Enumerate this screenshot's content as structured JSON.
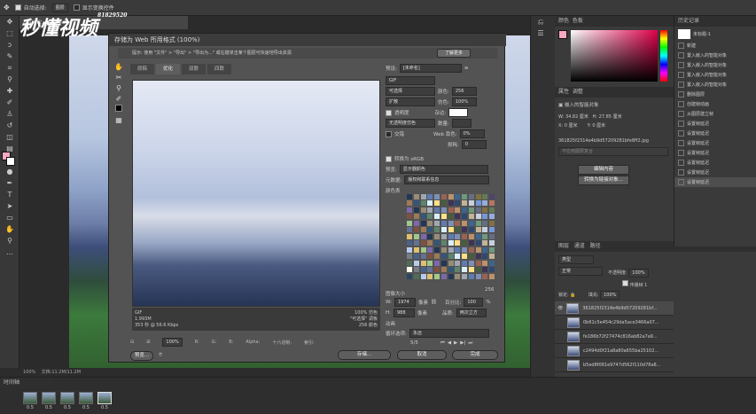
{
  "options_bar": {
    "auto_select": "自动选择:",
    "auto_select_value": "图层",
    "show_transform": "显示变换控件"
  },
  "doc_tab": "8fa0ff2, RGB/8#)",
  "watermark": {
    "text": "秒懂视频",
    "sub": "81829520"
  },
  "dialog": {
    "title": "存储为 Web 所用格式 (100%)",
    "tip": "提示: 使用 \"文件\" > \"导出\" > \"导出为...\" 或右键单击某个图层可快速地导出资源",
    "tip_button": "了解更多",
    "tabs": [
      "原稿",
      "优化",
      "双联",
      "四联"
    ],
    "preview_info_left": [
      "GIF",
      "1.993M",
      "353 秒 @ 56.6 Kbps"
    ],
    "preview_info_right": [
      "100% 仿色",
      "\"可选择\" 调板",
      "256 颜色"
    ],
    "preset_label": "预设:",
    "preset_value": "[未命名]",
    "format": "GIF",
    "reduction": "可选择",
    "colors_label": "颜色:",
    "colors_value": "256",
    "dither_algo": "扩散",
    "dither_label": "仿色:",
    "dither_value": "100%",
    "transparency": "透明度",
    "matte_label": "杂边:",
    "no_transparency_dither": "无透明度仿色",
    "amount_label": "数量:",
    "interlaced": "交错",
    "web_snap_label": "Web 靠色:",
    "web_snap_value": "0%",
    "lossy_label": "损耗:",
    "lossy_value": "0",
    "convert_srgb": "转换为 sRGB",
    "preview_label": "预览:",
    "preview_value": "显示器颜色",
    "metadata_label": "元数据:",
    "metadata_value": "版权和联系信息",
    "color_table_label": "颜色表",
    "color_count": "256",
    "image_size_label": "图像大小",
    "width_label": "W:",
    "width_value": "1974",
    "height_label": "H:",
    "height_value": "988",
    "px": "像素",
    "percent_label": "百分比:",
    "percent_value": "100",
    "quality_label": "品质:",
    "quality_value": "两次立方",
    "animation_label": "动画",
    "loop_label": "循环选项:",
    "loop_value": "永远",
    "frame_counter": "5/5",
    "zoom": "100%",
    "r_label": "R:",
    "g_label": "G:",
    "b_label": "B:",
    "alpha_label": "Alpha:",
    "hex_label": "十六进制:",
    "index_label": "索引:",
    "preview_button": "预览...",
    "save_button": "存储...",
    "cancel_button": "取消",
    "done_button": "完成"
  },
  "status_bar": {
    "zoom": "100%",
    "doc": "文档:11.2M/11.2M"
  },
  "timeline": {
    "tab": "时间轴",
    "frame_times": [
      "0.5",
      "0.5",
      "0.5",
      "0.5",
      "0.5"
    ]
  },
  "color_panel": {
    "tabs": [
      "颜色",
      "色板"
    ]
  },
  "properties_panel": {
    "tabs": [
      "属性",
      "调整"
    ],
    "type": "嵌入的智能对象",
    "w_label": "W:",
    "w_value": "34.82 厘米",
    "h_label": "H:",
    "h_value": "27.85 厘米",
    "x_label": "X:",
    "x_value": "0 厘米",
    "y_label": "Y:",
    "y_value": "0 厘米",
    "filename": "361825f2314e4b9d57209281bfe8ff2.jpg",
    "layer_comp_placeholder": "不应用图层复合",
    "edit_button": "编辑内容",
    "convert_button": "转换为链接对象..."
  },
  "history_panel": {
    "tabs": [
      "历史记录"
    ],
    "snapshot": "未标题-1",
    "items": [
      "新建",
      "置入嵌入的智能对象",
      "置入嵌入的智能对象",
      "置入嵌入的智能对象",
      "置入嵌入的智能对象",
      "删除图层",
      "创建帧动画",
      "从图层建立帧",
      "设置帧延迟",
      "设置帧延迟",
      "设置帧延迟",
      "设置帧延迟",
      "设置帧延迟",
      "设置帧延迟",
      "设置帧延迟"
    ]
  },
  "layers_panel": {
    "tabs": [
      "图层",
      "通道",
      "路径"
    ],
    "kind_label": "类型",
    "blend": "正常",
    "opacity_label": "不透明度:",
    "opacity_value": "100%",
    "lock_label": "锁定:",
    "fill_label": "填充:",
    "fill_value": "100%",
    "propagate": "传播帧 1",
    "unify_label": "统一:",
    "layers": [
      "361825f2314e4b9d57209281bf...",
      "0b61c5e454c29da5ace3466a07...",
      "fe186b72f27474c816ab82a7a9...",
      "c2494d0f21a8a80a655ba25102...",
      "b5ed8f081e9747d562f110d78a8..."
    ]
  },
  "colors": {
    "foreground": "#f6a9c0",
    "background": "#ffffff"
  }
}
